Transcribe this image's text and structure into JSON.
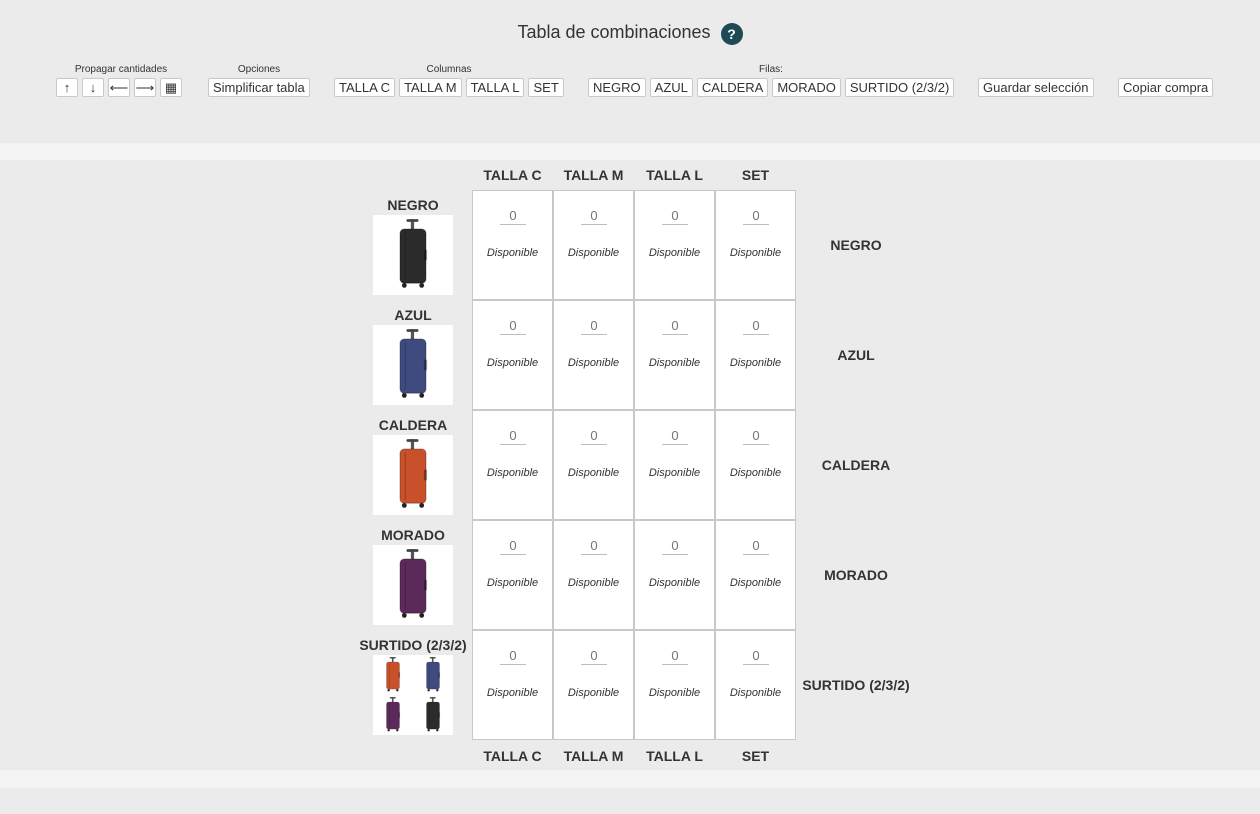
{
  "header": {
    "title": "Tabla de combinaciones",
    "help_symbol": "?"
  },
  "toolbar": {
    "propagate": {
      "label": "Propagar cantidades",
      "buttons": [
        {
          "glyph": "↑",
          "icon": "arrow-up-icon"
        },
        {
          "glyph": "↓",
          "icon": "arrow-down-icon"
        },
        {
          "glyph": "⟵",
          "icon": "arrow-left-icon"
        },
        {
          "glyph": "⟶",
          "icon": "arrow-right-icon"
        },
        {
          "glyph": "▦",
          "icon": "grid-icon"
        }
      ]
    },
    "options": {
      "label": "Opciones",
      "button": "Simplificar tabla"
    },
    "columns": {
      "label": "Columnas",
      "buttons": [
        "TALLA C",
        "TALLA M",
        "TALLA L",
        "SET"
      ]
    },
    "rows": {
      "label": "Filas:",
      "buttons": [
        "NEGRO",
        "AZUL",
        "CALDERA",
        "MORADO",
        "SURTIDO (2/3/2)"
      ]
    },
    "save_button": "Guardar selección",
    "copy_button": "Copiar compra"
  },
  "matrix": {
    "columns": [
      "TALLA C",
      "TALLA M",
      "TALLA L",
      "SET"
    ],
    "rows": [
      {
        "label": "NEGRO",
        "image": "suitcase-black",
        "color": "#2b2b2b"
      },
      {
        "label": "AZUL",
        "image": "suitcase-blue",
        "color": "#3f4a7e"
      },
      {
        "label": "CALDERA",
        "image": "suitcase-orange",
        "color": "#c8502a"
      },
      {
        "label": "MORADO",
        "image": "suitcase-purple",
        "color": "#5c2a5a"
      },
      {
        "label": "SURTIDO (2/3/2)",
        "image": "suitcase-assortment",
        "color": "multi"
      }
    ],
    "cell_value": "0",
    "cell_status": "Disponible"
  },
  "colors": {
    "help_badge": "#1d4a54",
    "background": "#ebebeb"
  }
}
